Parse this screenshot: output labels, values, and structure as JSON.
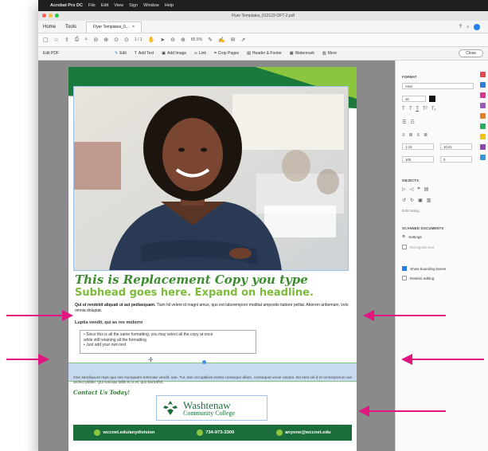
{
  "mac_menu": {
    "app": "Acrobat Pro DC",
    "items": [
      "File",
      "Edit",
      "View",
      "Sign",
      "Window",
      "Help"
    ]
  },
  "window": {
    "title": "Flyer Templates_012122-OFT-2.pdf"
  },
  "tabbar": {
    "home": "Home",
    "tools": "Tools",
    "doc_tab": "Flyer Templates_0...",
    "close_x": "×"
  },
  "toolbar": {
    "page": "1",
    "page_total": "/ 1",
    "zoom": "85.5%"
  },
  "editbar": {
    "label": "Edit PDF",
    "tools": [
      "Edit",
      "Add Text",
      "Add Image",
      "Link",
      "Crop Pages",
      "Header & Footer",
      "Watermark",
      "More"
    ],
    "close": "Close"
  },
  "flyer": {
    "headline": "This is Replacement Copy you type",
    "subhead": "Subhead goes here. Expand on headline.",
    "body1_bold": "Qui ut rendebit aliquati ut aut pediasquam.",
    "body1_rest": "Tium hil velent id magni amus, quo est laboremporo moditat ampostio tiabore pelliat. Aborem aribemam, volo omnia doluptat.",
    "subtitle2": "Luptia vendit, qui as res molorro",
    "bullets": [
      "• Since this is all the same formatting, you may select all the copy at once",
      "  while still retaining all the formatting",
      "• Just add your own text"
    ],
    "body2": "One sendiquunt repe quo inis micrquiam reheniae vendit, sae. Tur, tam occuptibus eossa consequo ellam, consequat venie utiunto. Ed esst vel d et omniniporum aut archici piditio. Qui tracoqu tallis is ra et, quo borunfint.",
    "contact": "Contact Us Today!",
    "logo_name": "Washtenaw",
    "logo_sub": "Community College",
    "footer": [
      "wccnet.edu/anydivision",
      "734-973-3300",
      "anyone@wccnet.edu"
    ]
  },
  "panel": {
    "format_title": "FORMAT",
    "font": "Arial",
    "size": "10",
    "line_spacing": "1.15",
    "para_spacing": "10.01",
    "scale": "100",
    "char_spacing": "0",
    "objects_title": "OBJECTS",
    "edit_using": "Edit Using...",
    "scanned_title": "SCANNED DOCUMENTS",
    "settings": "Settings",
    "recognize": "Recognize text",
    "show_bounding": "Show bounding boxes",
    "restrict": "Restrict editing"
  },
  "colors": {
    "arrow": "#e0157f",
    "green_dark": "#1b6e3b",
    "green_light": "#8cc63f",
    "headline": "#3c8c2e",
    "selection": "#c8daf0"
  }
}
